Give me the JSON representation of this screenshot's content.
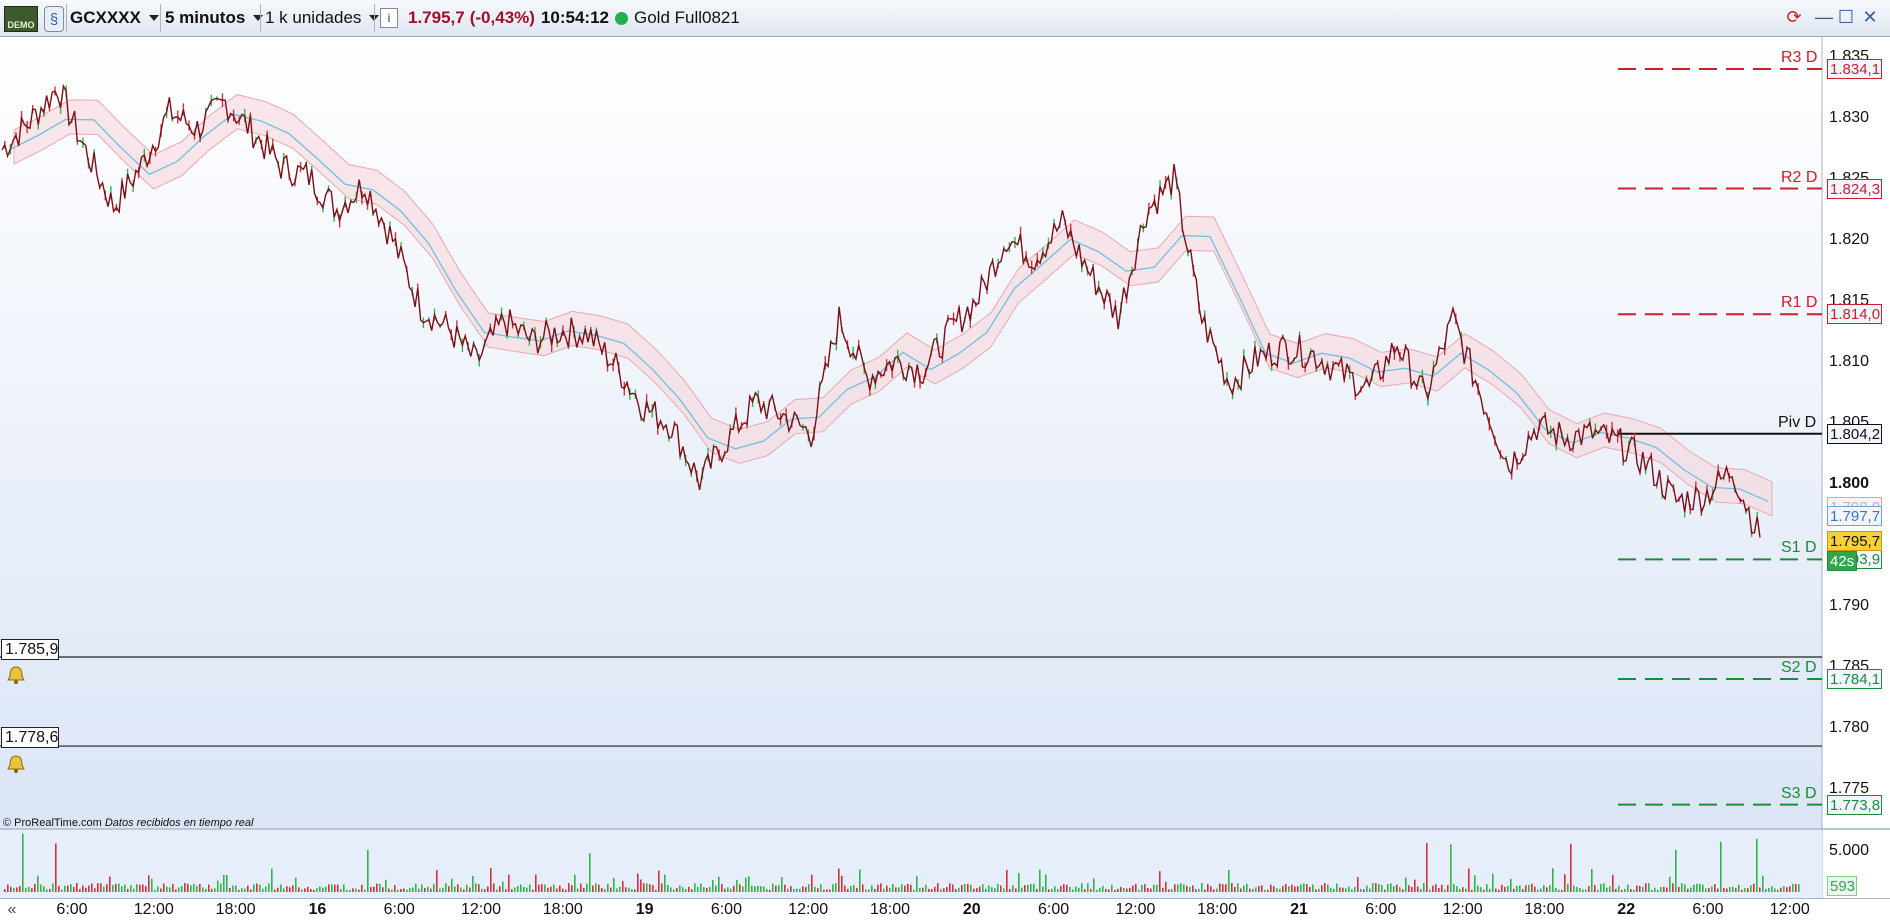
{
  "toolbar": {
    "demo_label": "DEMO",
    "instrument": "GCXXXX",
    "timeframe": "5 minutos",
    "units": "1 k unidades",
    "info_glyph": "i",
    "last_price": "1.795,7",
    "change": "(-0,43%)",
    "time": "10:54:12",
    "contract": "Gold Full0821",
    "price_color": "#a0102a"
  },
  "price_axis": {
    "ticks": [
      {
        "label": "1.835",
        "bold": false
      },
      {
        "label": "1.830",
        "bold": false
      },
      {
        "label": "1.825",
        "bold": false
      },
      {
        "label": "1.820",
        "bold": false
      },
      {
        "label": "1.815",
        "bold": false
      },
      {
        "label": "1.810",
        "bold": false
      },
      {
        "label": "1.805",
        "bold": false
      },
      {
        "label": "1.800",
        "bold": true
      },
      {
        "label": "1.795",
        "bold": false
      },
      {
        "label": "1.790",
        "bold": false
      },
      {
        "label": "1.785",
        "bold": false
      },
      {
        "label": "1.780",
        "bold": false
      },
      {
        "label": "1.775",
        "bold": false
      }
    ]
  },
  "pivot_levels": [
    {
      "name": "R3 D",
      "value": "1.834,1",
      "price": 1834.1,
      "color": "#c8202c",
      "style": "dashed"
    },
    {
      "name": "R2 D",
      "value": "1.824,3",
      "price": 1824.3,
      "color": "#c8202c",
      "style": "dashed"
    },
    {
      "name": "R1 D",
      "value": "1.814,0",
      "price": 1814.0,
      "color": "#c8202c",
      "style": "dashed"
    },
    {
      "name": "Piv D",
      "value": "1.804,2",
      "price": 1804.2,
      "color": "#111111",
      "style": "solid"
    },
    {
      "name": "S1 D",
      "value": "1.793,9",
      "price": 1793.9,
      "color": "#1d8a3a",
      "style": "dashed"
    },
    {
      "name": "S2 D",
      "value": "1.784,1",
      "price": 1784.1,
      "color": "#1d8a3a",
      "style": "dashed"
    },
    {
      "name": "S3 D",
      "value": "1.773,8",
      "price": 1773.8,
      "color": "#1d8a3a",
      "style": "dashed"
    }
  ],
  "indicator_boxes": {
    "cloud_top": "1.798,0",
    "kijun": "1.797,7",
    "current_price": "1.795,7",
    "countdown": "42s"
  },
  "alerts": [
    {
      "label": "1.785,9",
      "price": 1785.9
    },
    {
      "label": "1.778,6",
      "price": 1778.6
    }
  ],
  "copyright": {
    "brand": "© ProRealTime.com",
    "note": "Datos recibidos en tiempo real"
  },
  "volume": {
    "tick_label": "5.000",
    "current": "593"
  },
  "time_axis": [
    {
      "label": "6:00",
      "bold": false
    },
    {
      "label": "12:00",
      "bold": false
    },
    {
      "label": "18:00",
      "bold": false
    },
    {
      "label": "16",
      "bold": true
    },
    {
      "label": "6:00",
      "bold": false
    },
    {
      "label": "12:00",
      "bold": false
    },
    {
      "label": "18:00",
      "bold": false
    },
    {
      "label": "19",
      "bold": true
    },
    {
      "label": "6:00",
      "bold": false
    },
    {
      "label": "12:00",
      "bold": false
    },
    {
      "label": "18:00",
      "bold": false
    },
    {
      "label": "20",
      "bold": true
    },
    {
      "label": "6:00",
      "bold": false
    },
    {
      "label": "12:00",
      "bold": false
    },
    {
      "label": "18:00",
      "bold": false
    },
    {
      "label": "21",
      "bold": true
    },
    {
      "label": "6:00",
      "bold": false
    },
    {
      "label": "12:00",
      "bold": false
    },
    {
      "label": "18:00",
      "bold": false
    },
    {
      "label": "22",
      "bold": true
    },
    {
      "label": "6:00",
      "bold": false
    },
    {
      "label": "12:00",
      "bold": false
    }
  ],
  "chart_data": {
    "type": "line",
    "instrument": "GCXXXX",
    "series": [
      {
        "name": "Gold Full0821",
        "values": [
          1827.5,
          1829.8,
          1832.6,
          1827.4,
          1822.8,
          1826.2,
          1830.6,
          1829.2,
          1831.4,
          1828.9,
          1826.1,
          1825.3,
          1822.6,
          1824.7,
          1820.1,
          1814.6,
          1812.8,
          1810.1,
          1813.5,
          1811.8,
          1812.6,
          1812.4,
          1809.8,
          1806.4,
          1804.9,
          1800.3,
          1803.7,
          1806.8,
          1805.7,
          1804.2,
          1813.6,
          1808.8,
          1810.2,
          1809.4,
          1812.7,
          1815.4,
          1820.3,
          1818.6,
          1821.5,
          1817.3,
          1813.8,
          1822.4,
          1825.1,
          1813.6,
          1808.3,
          1810.4,
          1811.3,
          1810.7,
          1809.2,
          1807.9,
          1811.6,
          1807.2,
          1813.6,
          1807.4,
          1801.6,
          1804.8,
          1803.9,
          1804.2,
          1803.4,
          1801.6,
          1798.7,
          1799.1,
          1801.2,
          1795.7
        ]
      }
    ],
    "ylim": [
      1773,
      1836
    ],
    "ticks": [
      "1.835",
      "1.830",
      "1.825",
      "1.820",
      "1.815",
      "1.810",
      "1.805",
      "1.800",
      "1.795",
      "1.790",
      "1.785",
      "1.780",
      "1.775"
    ],
    "x_tick_labels": [
      "6:00",
      "12:00",
      "18:00",
      "16",
      "6:00",
      "12:00",
      "18:00",
      "19",
      "6:00",
      "12:00",
      "18:00",
      "20",
      "6:00",
      "12:00",
      "18:00",
      "21",
      "6:00",
      "12:00",
      "18:00",
      "22",
      "6:00",
      "12:00"
    ],
    "volume_current": 593,
    "grid": false
  }
}
